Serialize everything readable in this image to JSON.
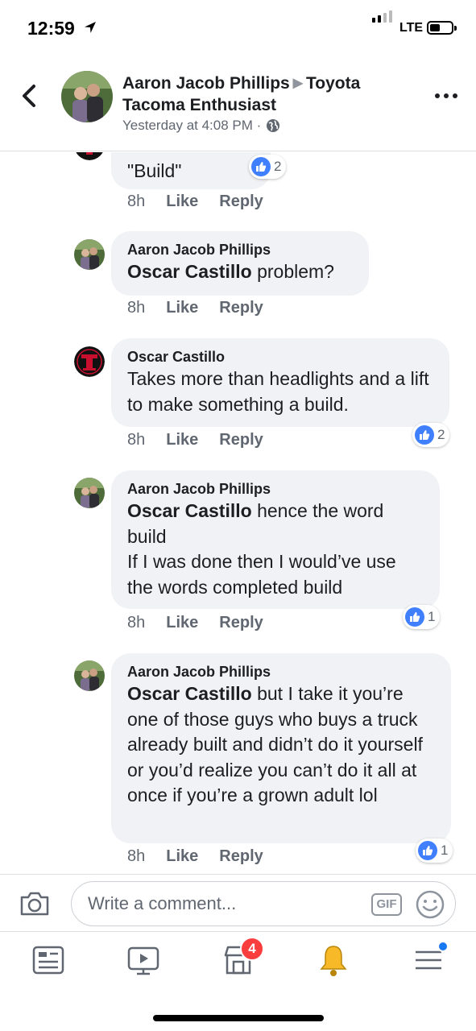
{
  "status": {
    "time": "12:59",
    "network": "LTE"
  },
  "header": {
    "author": "Aaron Jacob Phillips",
    "group": "Toyota Tacoma Enthusiast",
    "meta": "Yesterday at 4:08 PM ·",
    "icons": {
      "back": "chevron-left-icon",
      "globe": "globe-icon",
      "more": "more-dots-icon"
    }
  },
  "comments": [
    {
      "author": "",
      "text": "\"Build\"",
      "time": "8h",
      "like": "Like",
      "reply": "Reply",
      "reactions": "2"
    },
    {
      "author": "Aaron Jacob Phillips",
      "mention": "Oscar Castillo",
      "text": " problem?",
      "time": "8h",
      "like": "Like",
      "reply": "Reply",
      "reactions": ""
    },
    {
      "author": "Oscar Castillo",
      "text": "Takes more than headlights and a lift to make something a build.",
      "time": "8h",
      "like": "Like",
      "reply": "Reply",
      "reactions": "2"
    },
    {
      "author": "Aaron Jacob Phillips",
      "mention": "Oscar Castillo",
      "text": " hence the word build",
      "text2": "If I was done then I would’ve use the words completed build",
      "time": "8h",
      "like": "Like",
      "reply": "Reply",
      "reactions": "1"
    },
    {
      "author": "Aaron Jacob Phillips",
      "mention": "Oscar Castillo",
      "text": " but I take it you’re one of those guys who buys a truck already built and didn’t do it yourself or you’d realize you can’t do it all at once if you’re a grown adult lol",
      "time": "8h",
      "like": "Like",
      "reply": "Reply",
      "reactions": "1"
    }
  ],
  "composer": {
    "placeholder": "Write a comment...",
    "gif_label": "GIF"
  },
  "tabbar": {
    "tabs": [
      "news-feed-icon",
      "watch-icon",
      "marketplace-icon",
      "notifications-icon",
      "menu-icon"
    ],
    "marketplace_badge": "4"
  },
  "colors": {
    "like_blue": "#4080ff",
    "bubble": "#f0f2f5",
    "badge_red": "#fa3e3e",
    "notif_yellow": "#f7b928"
  }
}
